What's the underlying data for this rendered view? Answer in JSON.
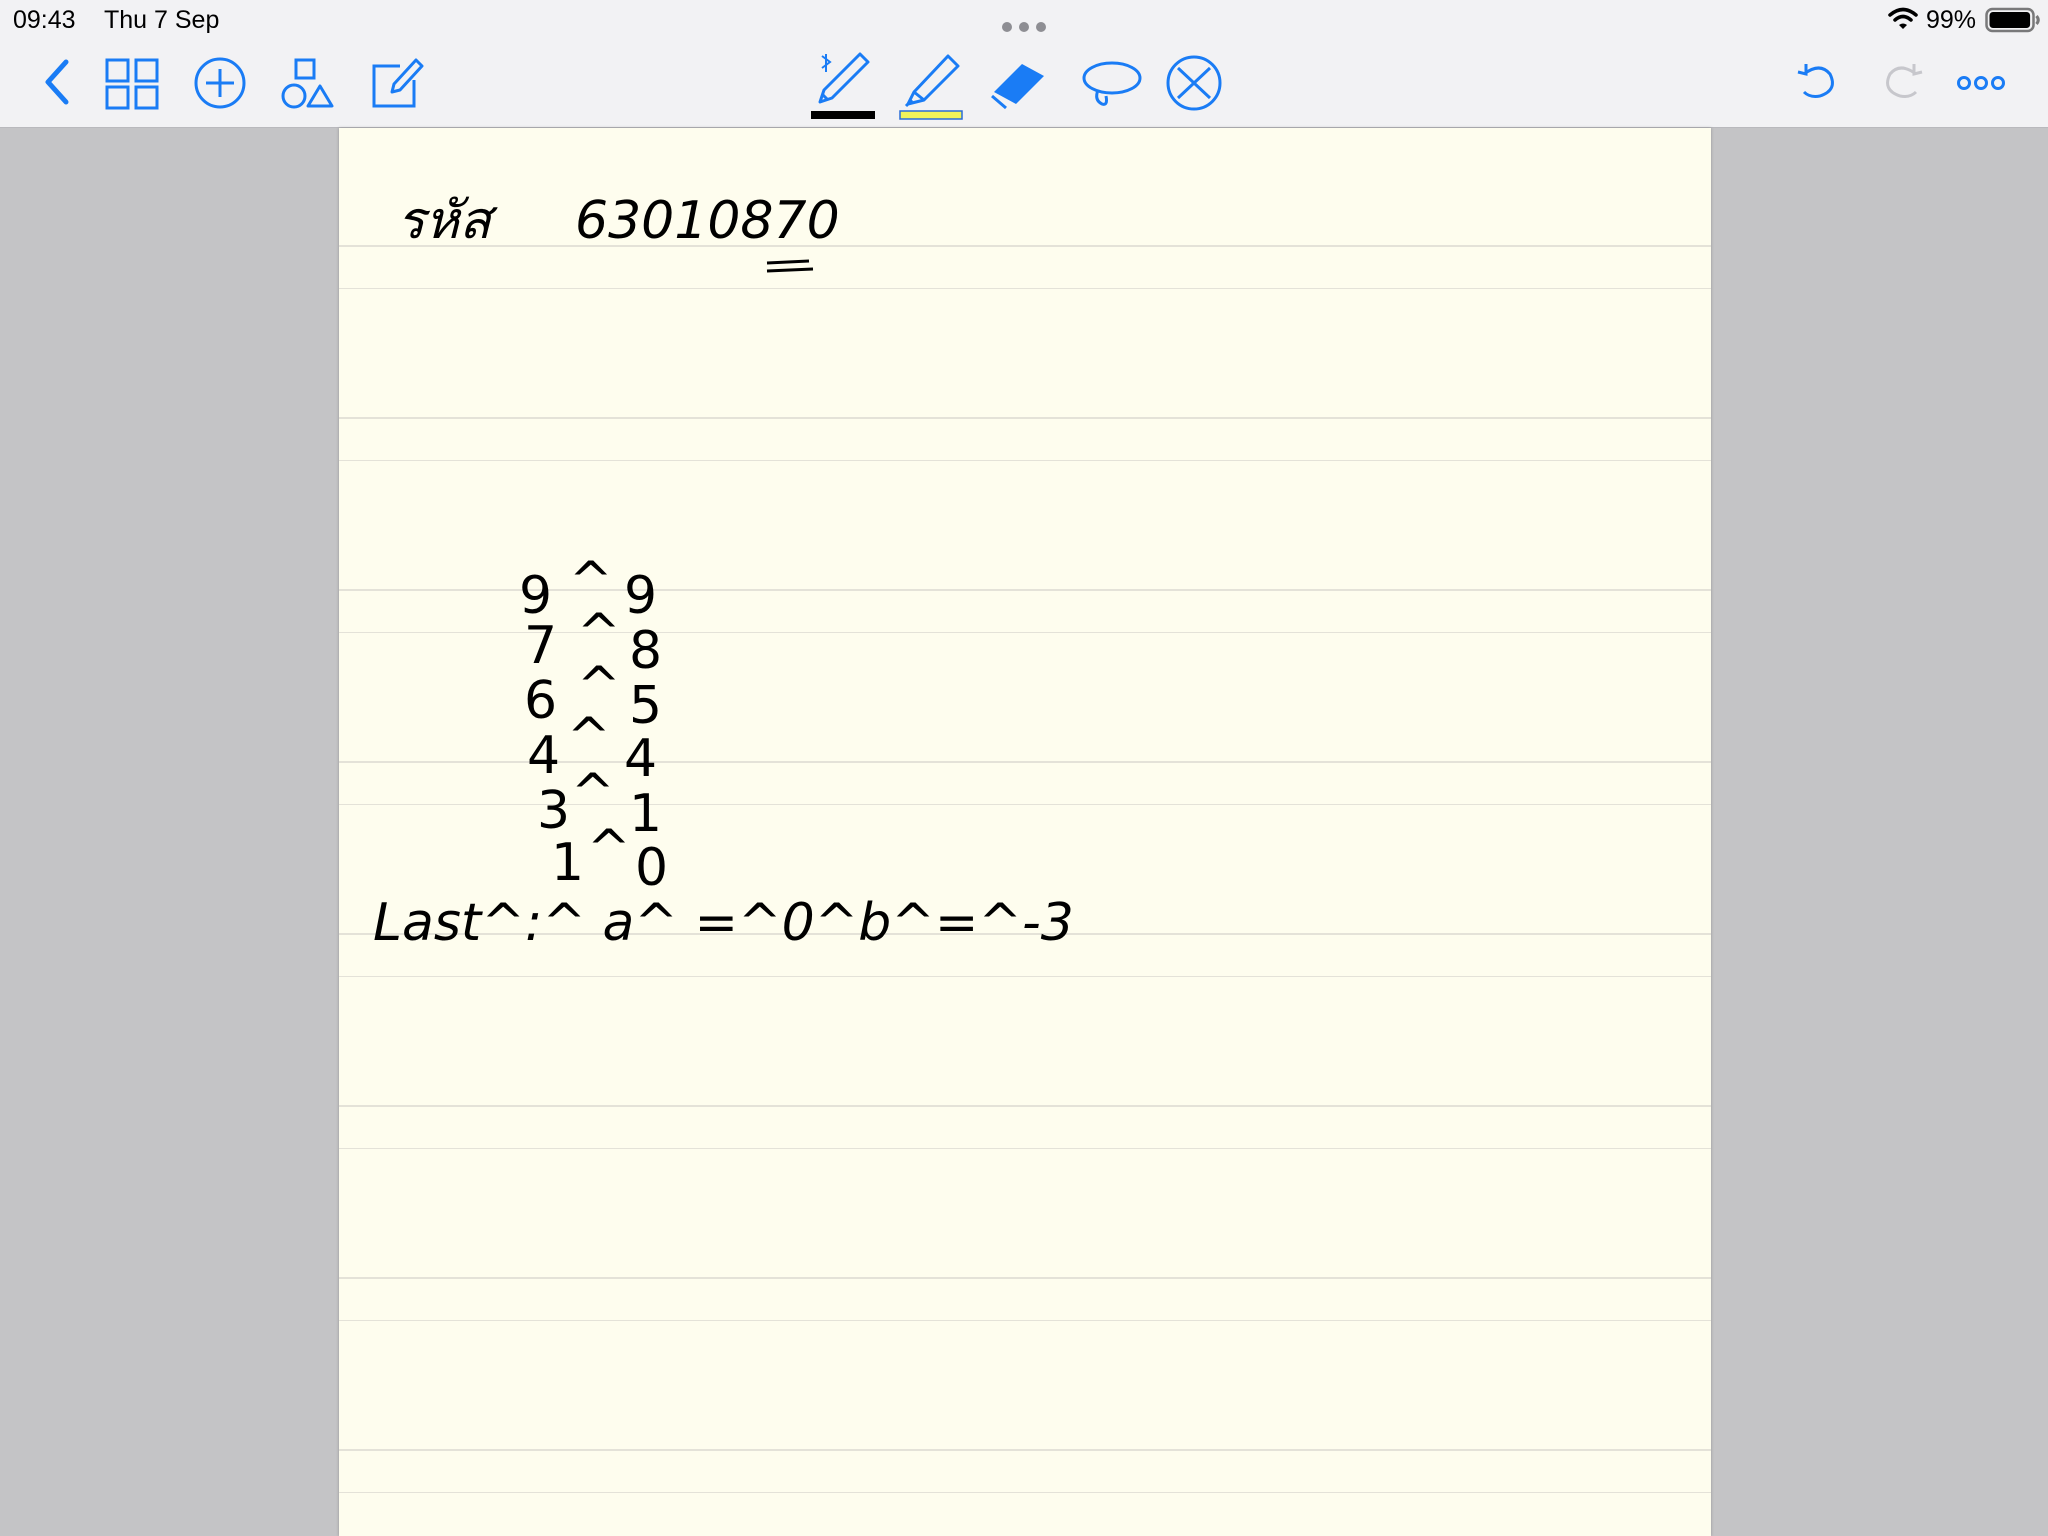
{
  "status_bar": {
    "time": "09:43",
    "date": "Thu 7 Sep",
    "multitask_dots": "•••",
    "battery_percent": "99%",
    "battery_level": 0.99
  },
  "toolbar": {
    "accent_color": "#1a7cf5",
    "pen_color": "#000000",
    "highlighter_color": "#f3f35a",
    "left_icons": [
      "back-chevron-icon",
      "grid-icon",
      "add-circle-icon",
      "shapes-icon",
      "edit-icon"
    ],
    "tools": [
      "pen-icon",
      "highlighter-icon",
      "eraser-icon",
      "lasso-icon",
      "close-circle-icon"
    ],
    "right_icons": [
      "undo-icon",
      "redo-icon",
      "more-icon"
    ]
  },
  "note": {
    "header_label": "รหัส",
    "student_id": "63010870",
    "rows": [
      {
        "left": "9",
        "op": "^",
        "right": "9"
      },
      {
        "left": "7",
        "op": "^",
        "right": "8"
      },
      {
        "left": "6",
        "op": "^",
        "right": "5"
      },
      {
        "left": "4",
        "op": "^",
        "right": "4"
      },
      {
        "left": "3",
        "op": "^",
        "right": "1"
      },
      {
        "left": "1",
        "op": "^",
        "right": "0"
      }
    ],
    "last_line": "Last^:^ a^ =^0^b^=^-3"
  }
}
